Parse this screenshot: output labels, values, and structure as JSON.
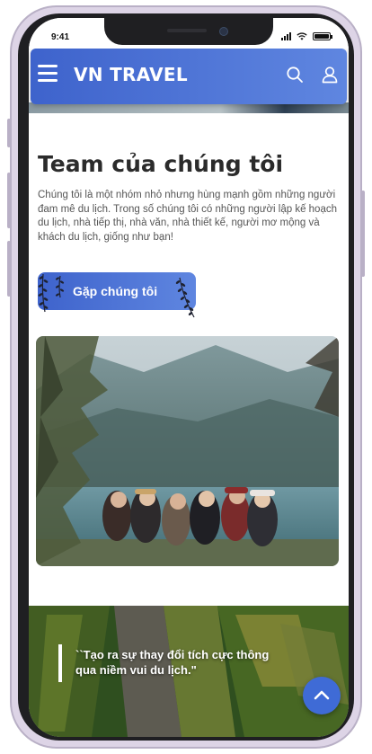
{
  "status_bar": {
    "time": "9:41"
  },
  "header": {
    "brand": "VN TRAVEL",
    "menu_icon": "hamburger-menu-icon",
    "search_icon": "search-icon",
    "user_icon": "user-icon"
  },
  "team": {
    "title": "Team của chúng tôi",
    "description": "Chúng tôi là một nhóm nhỏ nhưng hùng mạnh gồm những người đam mê du lịch. Trong số chúng tôi có những người lập kế hoạch du lịch, nhà tiếp thị, nhà văn, nhà thiết kế, người mơ mộng và khách du lịch, giống như bạn!",
    "cta_label": "Gặp chúng tôi",
    "photo_icon": "group-photo-image"
  },
  "quote": {
    "text": "``Tạo ra sự thay đổi tích cực thông qua niềm vui du lịch.\""
  },
  "back_to_top_icon": "chevron-up-icon",
  "colors": {
    "accent": "#3e63cc",
    "accent_light": "#5f86e0",
    "heading": "#2b2b2b",
    "body_text": "#555555"
  }
}
